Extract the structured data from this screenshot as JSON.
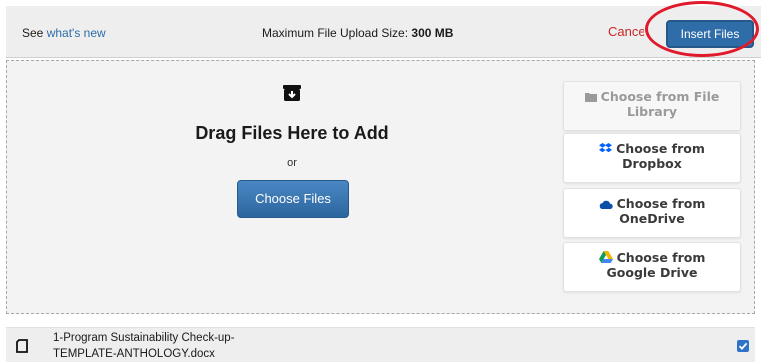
{
  "header": {
    "see_prefix": "See",
    "whats_new_link": "what's new",
    "max_size_label": "Maximum File Upload Size:",
    "max_size_value": "300 MB",
    "cancel_label": "Cancel",
    "insert_label": "Insert Files"
  },
  "dropzone": {
    "title": "Drag Files Here to Add",
    "or_text": "or",
    "choose_files_label": "Choose Files",
    "icon": "archive-download-icon"
  },
  "sources": [
    {
      "line1": "Choose from File",
      "line2": "Library",
      "icon": "folder-icon",
      "disabled": true
    },
    {
      "line1": "Choose from",
      "line2": "Dropbox",
      "icon": "dropbox-icon",
      "disabled": false
    },
    {
      "line1": "Choose from",
      "line2": "OneDrive",
      "icon": "onedrive-cloud-icon",
      "disabled": false
    },
    {
      "line1": "Choose from",
      "line2": "Google Drive",
      "icon": "google-drive-icon",
      "disabled": false
    }
  ],
  "files": [
    {
      "name_line1": "1-Program Sustainability Check-up-",
      "name_line2": "TEMPLATE-ANTHOLOGY.docx",
      "checked": true,
      "icon": "document-icon"
    }
  ],
  "colors": {
    "primary": "#2f6da8",
    "cancel": "#c62828",
    "annotation_circle": "#e0192b",
    "dropbox": "#0061fe",
    "onedrive": "#0a4fa8"
  }
}
